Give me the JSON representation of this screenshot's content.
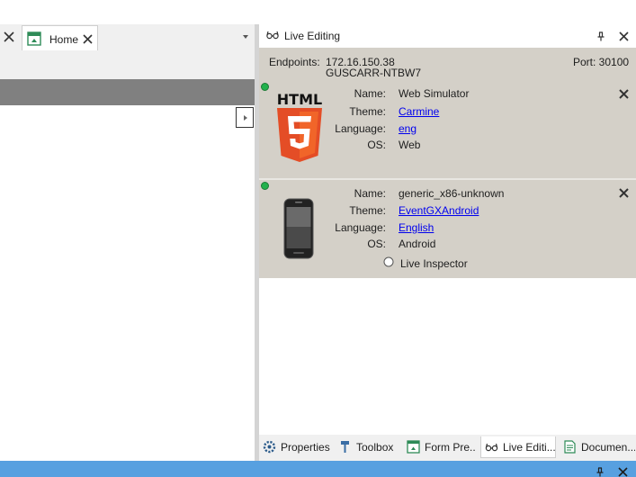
{
  "left_pane": {
    "home_tab": {
      "label": "Home",
      "icon": "home-page-icon"
    }
  },
  "panel": {
    "title": "Live Editing",
    "endpoints": {
      "label": "Endpoints:",
      "ip": "172.16.150.38",
      "host": "GUSCARR-NTBW7",
      "port": "Port: 30100"
    },
    "devices": [
      {
        "icon": "html5-logo",
        "logo_text": "HTML",
        "status_color": "#22b14c",
        "name_label": "Name:",
        "name": "Web Simulator",
        "theme_label": "Theme:",
        "theme": "Carmine",
        "language_label": "Language:",
        "language": "eng",
        "os_label": "OS:",
        "os": "Web"
      },
      {
        "icon": "android-phone-icon",
        "status_color": "#22b14c",
        "name_label": "Name:",
        "name": "generic_x86-unknown",
        "theme_label": "Theme:",
        "theme": "EventGXAndroid",
        "language_label": "Language:",
        "language": "English",
        "os_label": "OS:",
        "os": "Android",
        "inspector_label": "Live Inspector"
      }
    ]
  },
  "bottom_tabs": [
    {
      "label": "Properties",
      "icon": "properties-gear-icon"
    },
    {
      "label": "Toolbox",
      "icon": "toolbox-hammer-icon"
    },
    {
      "label": "Form Pre...",
      "icon": "form-preview-icon"
    },
    {
      "label": "Live Editi...",
      "icon": "live-editing-glasses-icon"
    },
    {
      "label": "Documen...",
      "icon": "document-icon"
    }
  ],
  "colors": {
    "accent_bar": "#57a0e0",
    "panel_bg": "#d4d0c8",
    "link": "#0000ee",
    "html5_orange": "#e44d26"
  }
}
